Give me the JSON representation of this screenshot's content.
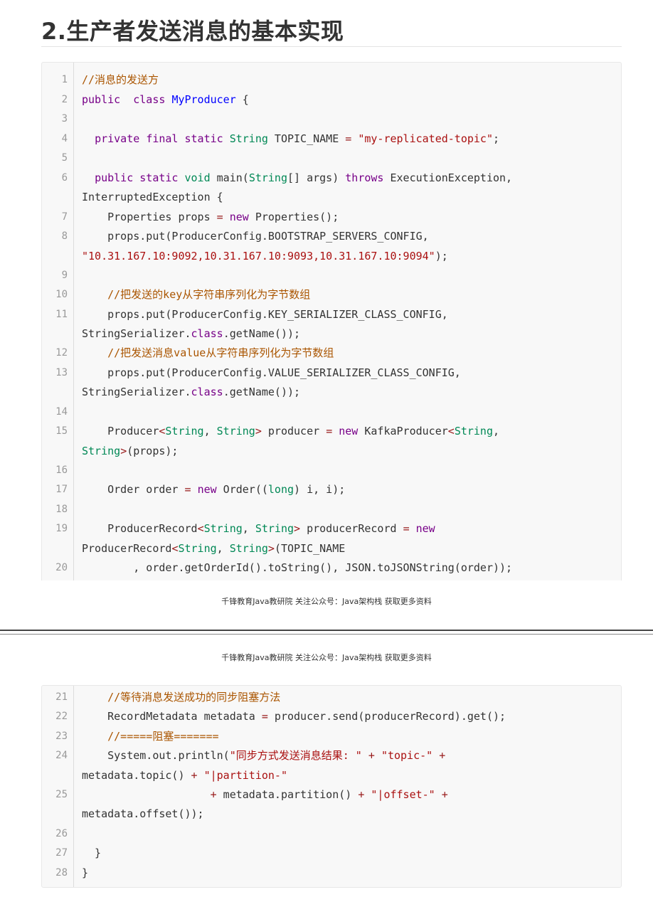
{
  "title": "2.生产者发送消息的基本实现",
  "footer_text": "千锋教育Java教研院 关注公众号：Java架构栈 获取更多资料",
  "colors": {
    "comment": "#aa5500",
    "keyword": "#770088",
    "type": "#008855",
    "definition": "#0000ff",
    "string": "#aa1111",
    "operator": "#981a1a"
  },
  "block1": {
    "line_numbers": [
      "1",
      "2",
      "3",
      "4",
      "5",
      "6",
      "7",
      "8",
      "9",
      "10",
      "11",
      "12",
      "13",
      "14",
      "15",
      "16",
      "17",
      "18",
      "19",
      "20"
    ],
    "lines": [
      [
        [
          "cm",
          "//消息的发送方"
        ]
      ],
      [
        [
          "kw",
          "public"
        ],
        [
          "",
          "  "
        ],
        [
          "kw",
          "class"
        ],
        [
          "",
          " "
        ],
        [
          "df",
          "MyProducer"
        ],
        [
          "",
          " {"
        ]
      ],
      [],
      [
        [
          "",
          "  "
        ],
        [
          "kw",
          "private"
        ],
        [
          "",
          " "
        ],
        [
          "kw",
          "final"
        ],
        [
          "",
          " "
        ],
        [
          "kw",
          "static"
        ],
        [
          "",
          " "
        ],
        [
          "ty",
          "String"
        ],
        [
          "",
          " TOPIC_NAME "
        ],
        [
          "op",
          "="
        ],
        [
          "",
          " "
        ],
        [
          "st",
          "\"my-replicated-topic\""
        ],
        [
          "",
          ";"
        ]
      ],
      [],
      [
        [
          "",
          "  "
        ],
        [
          "kw",
          "public"
        ],
        [
          "",
          " "
        ],
        [
          "kw",
          "static"
        ],
        [
          "",
          " "
        ],
        [
          "ty",
          "void"
        ],
        [
          "",
          " main("
        ],
        [
          "ty",
          "String"
        ],
        [
          "",
          "[] args) "
        ],
        [
          "kw",
          "throws"
        ],
        [
          "",
          " ExecutionException,"
        ]
      ],
      [
        [
          "",
          "InterruptedException {"
        ]
      ],
      [
        [
          "",
          "    Properties props "
        ],
        [
          "op",
          "="
        ],
        [
          "",
          " "
        ],
        [
          "kw",
          "new"
        ],
        [
          "",
          " Properties();"
        ]
      ],
      [
        [
          "",
          "    props.put(ProducerConfig.BOOTSTRAP_SERVERS_CONFIG,"
        ]
      ],
      [
        [
          "st",
          "\"10.31.167.10:9092,10.31.167.10:9093,10.31.167.10:9094\""
        ],
        [
          "",
          ");"
        ]
      ],
      [],
      [
        [
          "",
          "    "
        ],
        [
          "cm",
          "//把发送的key从字符串序列化为字节数组"
        ]
      ],
      [
        [
          "",
          "    props.put(ProducerConfig.KEY_SERIALIZER_CLASS_CONFIG,"
        ]
      ],
      [
        [
          "",
          "StringSerializer."
        ],
        [
          "kw",
          "class"
        ],
        [
          "",
          ".getName());"
        ]
      ],
      [
        [
          "",
          "    "
        ],
        [
          "cm",
          "//把发送消息value从字符串序列化为字节数组"
        ]
      ],
      [
        [
          "",
          "    props.put(ProducerConfig.VALUE_SERIALIZER_CLASS_CONFIG,"
        ]
      ],
      [
        [
          "",
          "StringSerializer."
        ],
        [
          "kw",
          "class"
        ],
        [
          "",
          ".getName());"
        ]
      ],
      [],
      [
        [
          "",
          "    Producer"
        ],
        [
          "op",
          "<"
        ],
        [
          "ty",
          "String"
        ],
        [
          "",
          ", "
        ],
        [
          "ty",
          "String"
        ],
        [
          "op",
          ">"
        ],
        [
          "",
          " producer "
        ],
        [
          "op",
          "="
        ],
        [
          "",
          " "
        ],
        [
          "kw",
          "new"
        ],
        [
          "",
          " KafkaProducer"
        ],
        [
          "op",
          "<"
        ],
        [
          "ty",
          "String"
        ],
        [
          "",
          ","
        ]
      ],
      [
        [
          "ty",
          "String"
        ],
        [
          "op",
          ">"
        ],
        [
          "",
          "(props);"
        ]
      ],
      [],
      [
        [
          "",
          "    Order order "
        ],
        [
          "op",
          "="
        ],
        [
          "",
          " "
        ],
        [
          "kw",
          "new"
        ],
        [
          "",
          " Order(("
        ],
        [
          "ty",
          "long"
        ],
        [
          "",
          ") i, i);"
        ]
      ],
      [],
      [
        [
          "",
          "    ProducerRecord"
        ],
        [
          "op",
          "<"
        ],
        [
          "ty",
          "String"
        ],
        [
          "",
          ", "
        ],
        [
          "ty",
          "String"
        ],
        [
          "op",
          ">"
        ],
        [
          "",
          " producerRecord "
        ],
        [
          "op",
          "="
        ],
        [
          "",
          " "
        ],
        [
          "kw",
          "new"
        ]
      ],
      [
        [
          "",
          "ProducerRecord"
        ],
        [
          "op",
          "<"
        ],
        [
          "ty",
          "String"
        ],
        [
          "",
          ", "
        ],
        [
          "ty",
          "String"
        ],
        [
          "op",
          ">"
        ],
        [
          "",
          "(TOPIC_NAME"
        ]
      ],
      [
        [
          "",
          "        , order.getOrderId().toString(), JSON.toJSONString(order));"
        ]
      ]
    ]
  },
  "block2": {
    "line_numbers": [
      "21",
      "22",
      "23",
      "24",
      "25",
      "26",
      "27",
      "28"
    ],
    "lines": [
      [
        [
          "",
          "    "
        ],
        [
          "cm",
          "//等待消息发送成功的同步阻塞方法"
        ]
      ],
      [
        [
          "",
          "    RecordMetadata metadata "
        ],
        [
          "op",
          "="
        ],
        [
          "",
          " producer.send(producerRecord).get();"
        ]
      ],
      [
        [
          "",
          "    "
        ],
        [
          "cm",
          "//=====阻塞======="
        ]
      ],
      [
        [
          "",
          "    System.out.println("
        ],
        [
          "st",
          "\"同步方式发送消息结果: \""
        ],
        [
          "",
          " "
        ],
        [
          "op",
          "+"
        ],
        [
          "",
          " "
        ],
        [
          "st",
          "\"topic-\""
        ],
        [
          "",
          " "
        ],
        [
          "op",
          "+"
        ]
      ],
      [
        [
          "",
          "metadata.topic() "
        ],
        [
          "op",
          "+"
        ],
        [
          "",
          " "
        ],
        [
          "st",
          "\"|partition-\""
        ]
      ],
      [
        [
          "",
          "                    "
        ],
        [
          "op",
          "+"
        ],
        [
          "",
          " metadata.partition() "
        ],
        [
          "op",
          "+"
        ],
        [
          "",
          " "
        ],
        [
          "st",
          "\"|offset-\""
        ],
        [
          "",
          " "
        ],
        [
          "op",
          "+"
        ]
      ],
      [
        [
          "",
          "metadata.offset());"
        ]
      ],
      [],
      [
        [
          "",
          "  }"
        ]
      ],
      [
        [
          "",
          "}"
        ]
      ]
    ]
  }
}
